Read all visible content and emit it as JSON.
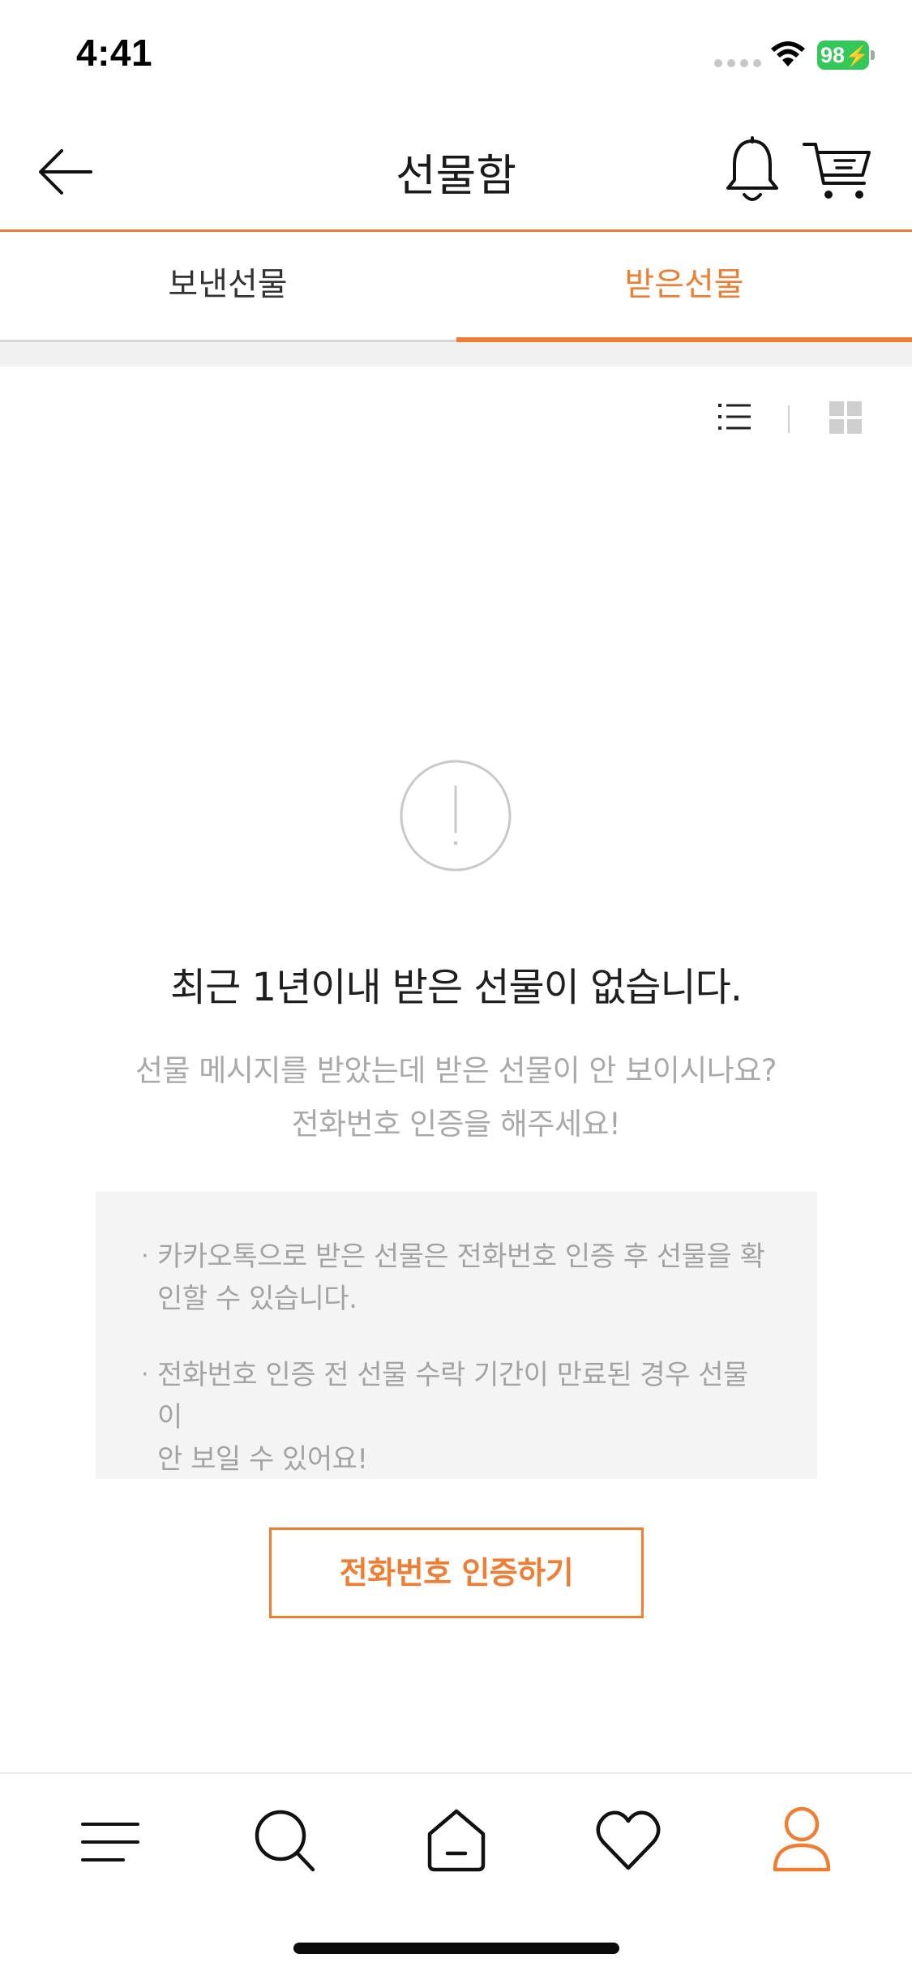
{
  "status_bar": {
    "time": "4:41",
    "battery": "98"
  },
  "header": {
    "title": "선물함"
  },
  "tabs": [
    {
      "label": "보낸선물",
      "active": false
    },
    {
      "label": "받은선물",
      "active": true
    }
  ],
  "view_toggle": {
    "options": [
      "list-icon",
      "grid-icon"
    ],
    "selected": "list-icon"
  },
  "empty_state": {
    "icon": "alert-circle-icon",
    "title": "최근 1년이내 받은 선물이 없습니다.",
    "description_line1": "선물 메시지를 받았는데 받은 선물이 안 보이시나요?",
    "description_line2": "전화번호 인증을 해주세요!"
  },
  "notice": {
    "bullet": "·",
    "items": [
      {
        "line1": "카카오톡으로 받은 선물은 전화번호 인증 후 선물을 확",
        "line2": "인할 수 있습니다."
      },
      {
        "line1": "전화번호 인증 전 선물 수락 기간이 만료된 경우 선물이",
        "line2": "안 보일 수 있어요!"
      }
    ]
  },
  "cta": {
    "label": "전화번호 인증하기"
  },
  "bottom_nav": {
    "items": [
      "menu-icon",
      "search-icon",
      "home-icon",
      "heart-icon",
      "user-icon"
    ],
    "active": "user-icon"
  },
  "colors": {
    "accent": "#ef7d32",
    "text_primary": "#1f1f1f",
    "text_secondary": "#a9a9a9",
    "notice_bg": "#f4f4f4",
    "battery": "#34c759"
  }
}
